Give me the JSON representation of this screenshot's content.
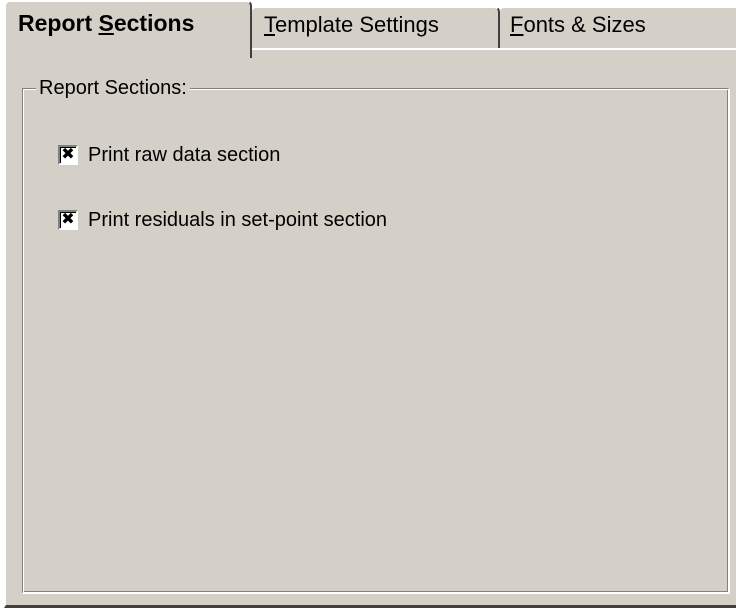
{
  "tabs": [
    {
      "label_pre": "Report ",
      "label_accel": "S",
      "label_post": "ections",
      "active": true
    },
    {
      "label_pre": "",
      "label_accel": "T",
      "label_post": "emplate Settings",
      "active": false
    },
    {
      "label_pre": "",
      "label_accel": "F",
      "label_post": "onts & Sizes",
      "active": false
    }
  ],
  "group": {
    "label": "Report Sections:"
  },
  "options": [
    {
      "label": "Print raw data section",
      "checked": true,
      "mark": "✖"
    },
    {
      "label": "Print residuals in set-point section",
      "checked": true,
      "mark": "✖"
    }
  ],
  "colors": {
    "face": "#d4d0c8",
    "highlight": "#ffffff",
    "shadow": "#808080",
    "dark_shadow": "#404040"
  }
}
